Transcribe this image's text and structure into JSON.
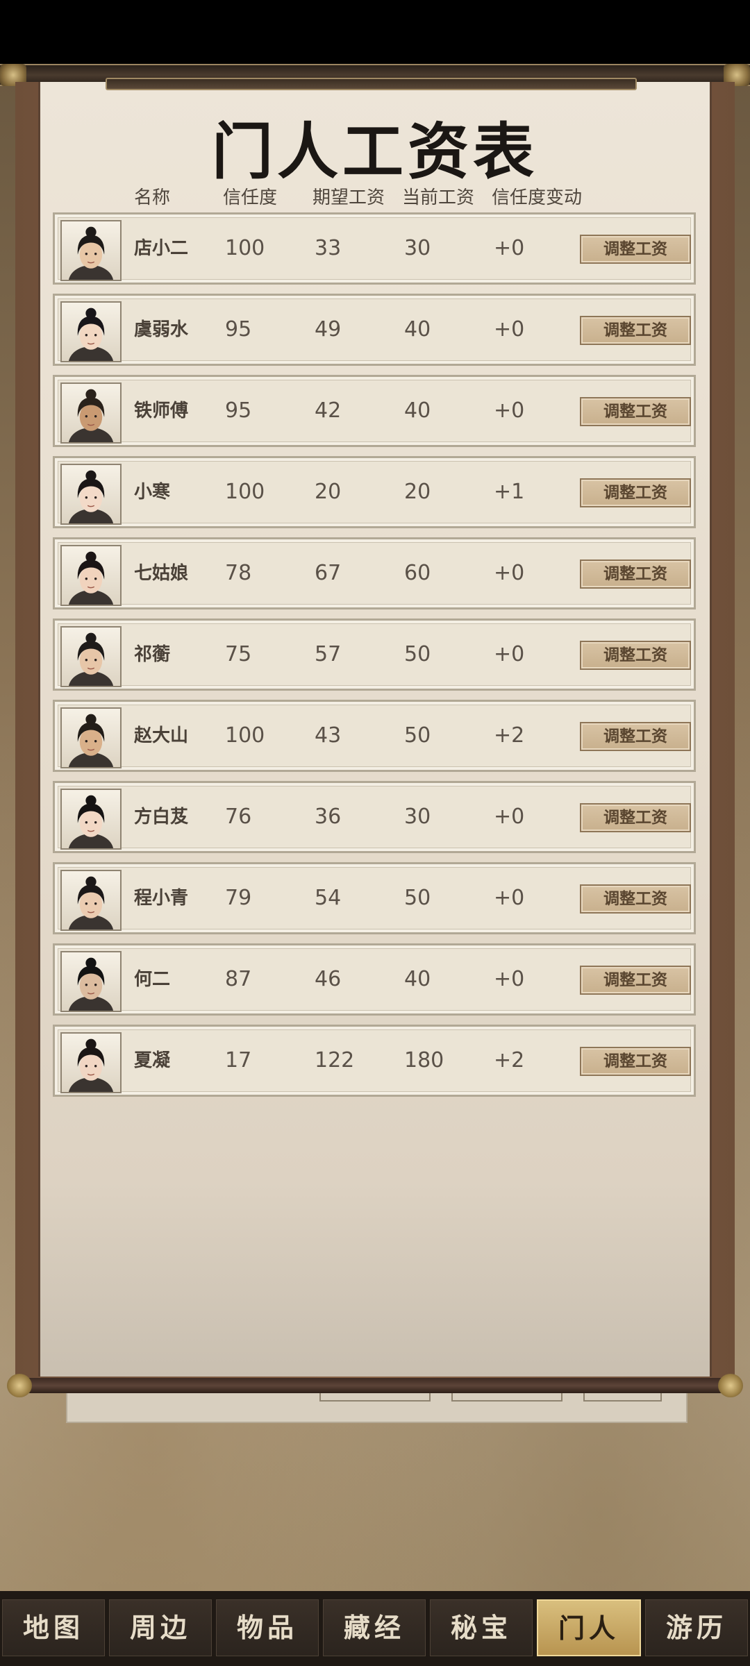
{
  "page": {
    "title": "门人工资表"
  },
  "headers": {
    "name": "名称",
    "trust": "信任度",
    "expected_wage": "期望工资",
    "current_wage": "当前工资",
    "trust_change": "信任度变动"
  },
  "adjust_label": "调整工资",
  "rows": [
    {
      "name": "店小二",
      "trust": "100",
      "expected": "33",
      "current": "30",
      "delta": "+0"
    },
    {
      "name": "虞弱水",
      "trust": "95",
      "expected": "49",
      "current": "40",
      "delta": "+0"
    },
    {
      "name": "铁师傅",
      "trust": "95",
      "expected": "42",
      "current": "40",
      "delta": "+0"
    },
    {
      "name": "小寒",
      "trust": "100",
      "expected": "20",
      "current": "20",
      "delta": "+1"
    },
    {
      "name": "七姑娘",
      "trust": "78",
      "expected": "67",
      "current": "60",
      "delta": "+0"
    },
    {
      "name": "祁蘅",
      "trust": "75",
      "expected": "57",
      "current": "50",
      "delta": "+0"
    },
    {
      "name": "赵大山",
      "trust": "100",
      "expected": "43",
      "current": "50",
      "delta": "+2"
    },
    {
      "name": "方白芨",
      "trust": "76",
      "expected": "36",
      "current": "30",
      "delta": "+0"
    },
    {
      "name": "程小青",
      "trust": "79",
      "expected": "54",
      "current": "50",
      "delta": "+0"
    },
    {
      "name": "何二",
      "trust": "87",
      "expected": "46",
      "current": "40",
      "delta": "+0"
    },
    {
      "name": "夏凝",
      "trust": "17",
      "expected": "122",
      "current": "180",
      "delta": "+2"
    }
  ],
  "nav": [
    {
      "label": "地图",
      "active": false
    },
    {
      "label": "周边",
      "active": false
    },
    {
      "label": "物品",
      "active": false
    },
    {
      "label": "藏经",
      "active": false
    },
    {
      "label": "秘宝",
      "active": false
    },
    {
      "label": "门人",
      "active": true
    },
    {
      "label": "游历",
      "active": false
    }
  ],
  "colors": {
    "paper": "#ede5d8",
    "frame": "#6e4f39",
    "nav_active": "#d9bf7e",
    "button": "#d8c3a4"
  }
}
